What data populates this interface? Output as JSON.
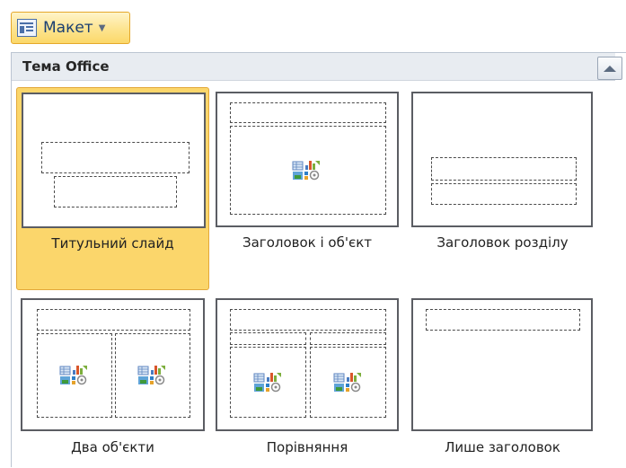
{
  "toolbar": {
    "layout_button_label": "Макет",
    "layout_button_icon": "slide-layout-icon",
    "dropdown_icon": "chevron-down-icon"
  },
  "gallery": {
    "section_title": "Тема Office",
    "scroll_icon": "scroll-up-arrow-icon",
    "selected_index": 0,
    "layouts": [
      {
        "name": "Титульний слайд"
      },
      {
        "name": "Заголовок і об'єкт"
      },
      {
        "name": "Заголовок розділу"
      },
      {
        "name": "Два об'єкти"
      },
      {
        "name": "Порівняння"
      },
      {
        "name": "Лише заголовок"
      }
    ]
  },
  "colors": {
    "selected_fill": "#fbd66b",
    "selected_border": "#e3a83a",
    "header_background": "#e8ecf1",
    "thumbnail_border": "#5b5d63"
  }
}
